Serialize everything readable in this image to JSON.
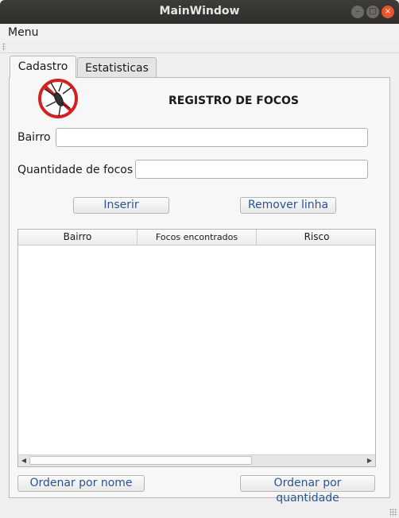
{
  "window": {
    "title": "MainWindow",
    "controls": {
      "minimize": "–",
      "maximize": "□",
      "close": "×"
    }
  },
  "menubar": {
    "menu": "Menu"
  },
  "tabs": [
    {
      "label": "Cadastro",
      "active": true
    },
    {
      "label": "Estatisticas",
      "active": false
    }
  ],
  "form": {
    "heading": "REGISTRO DE FOCOS",
    "logo_icon": "mosquito-prohibited-icon",
    "bairro_label": "Bairro",
    "bairro_value": "",
    "quantidade_label": "Quantidade de focos",
    "quantidade_value": "",
    "inserir_button": "Inserir",
    "remover_button": "Remover linha"
  },
  "table": {
    "columns": [
      "Bairro",
      "Focos encontrados",
      "Risco"
    ],
    "rows": []
  },
  "footer": {
    "sort_name_button": "Ordenar por nome",
    "sort_qty_button": "Ordenar por quantidade"
  },
  "colors": {
    "titlebar": "#2f2e2b",
    "close_button": "#e9542c",
    "button_text": "#2a5391",
    "logo_red": "#d42020"
  }
}
